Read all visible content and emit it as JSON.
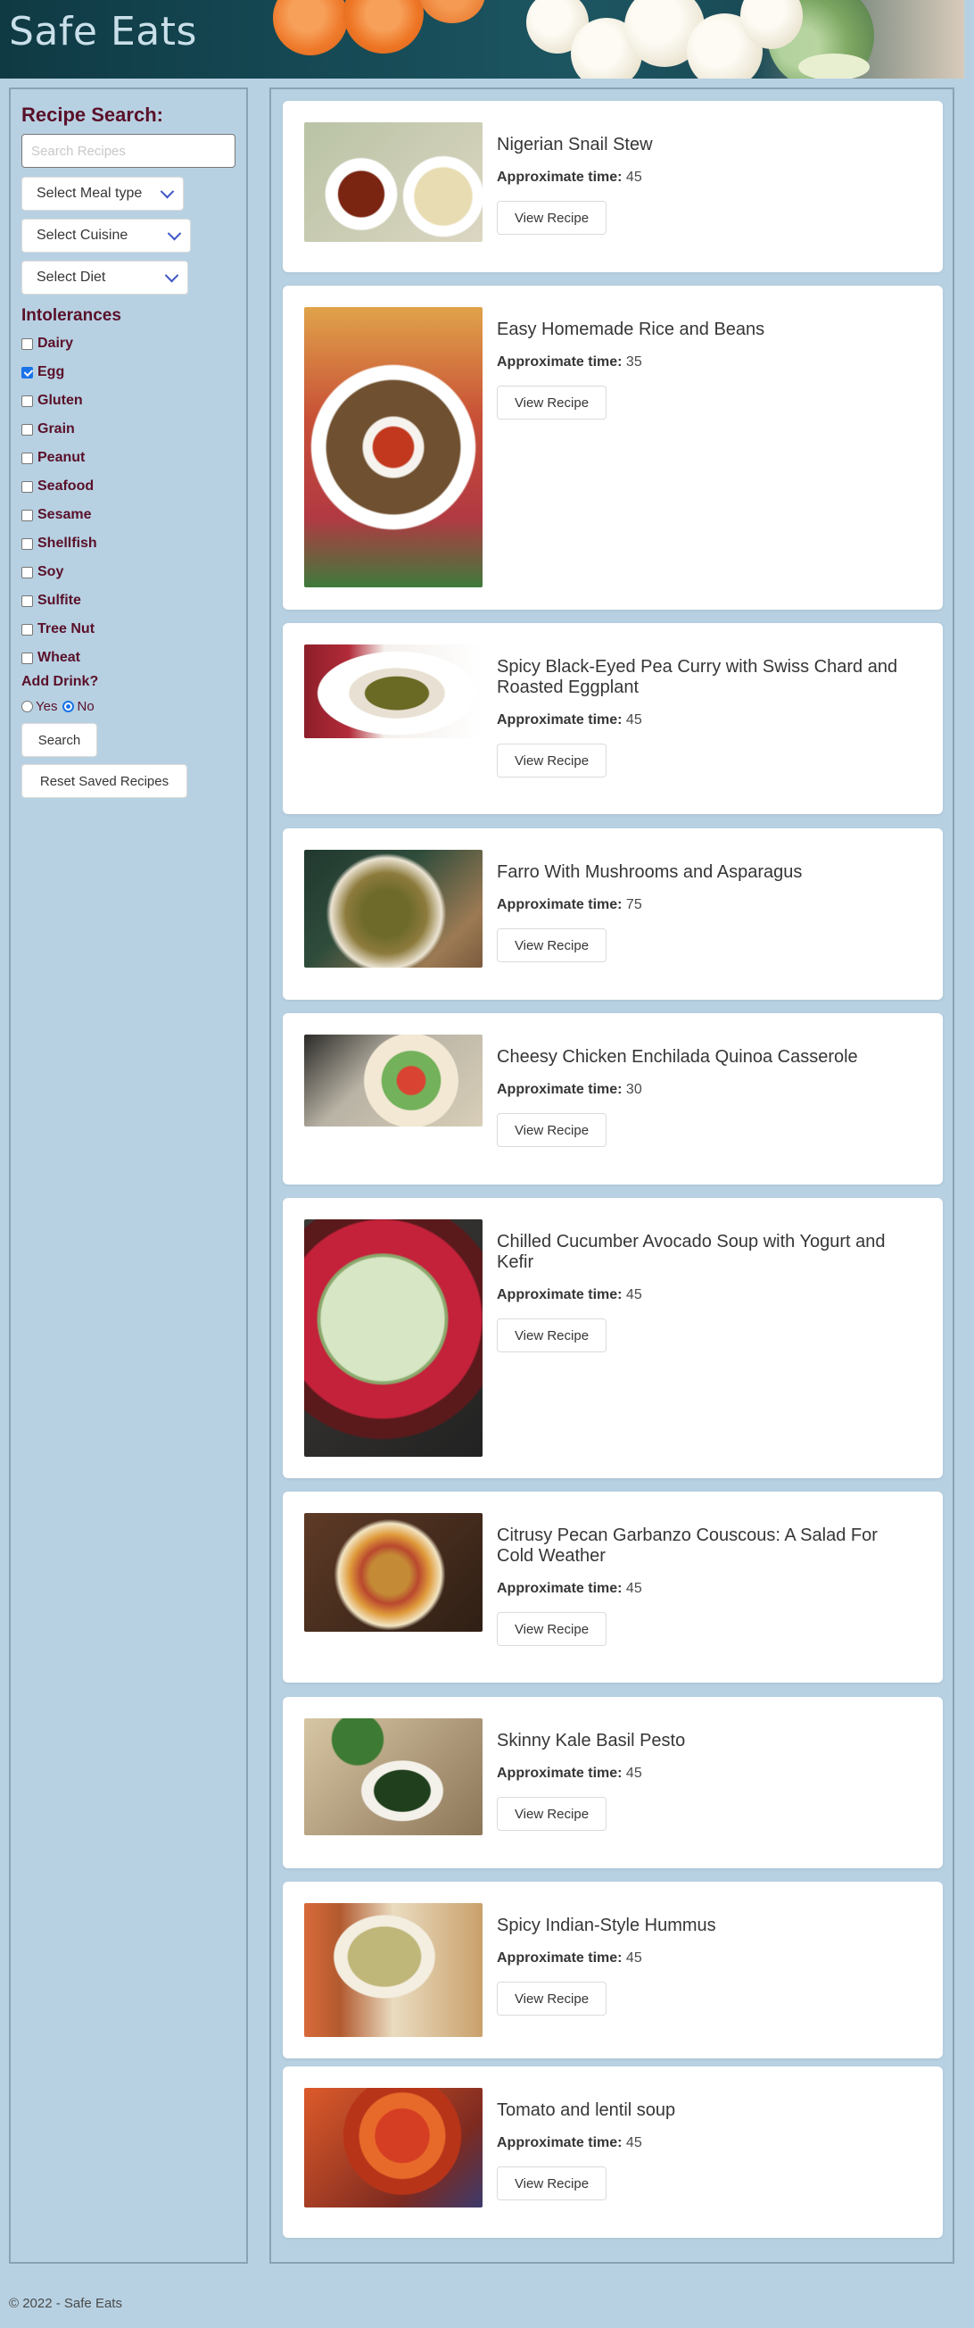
{
  "header": {
    "title": "Safe Eats"
  },
  "sidebar": {
    "heading": "Recipe Search:",
    "search_placeholder": "Search Recipes",
    "meal_type": "Select Meal type",
    "cuisine": "Select Cuisine",
    "diet": "Select Diet",
    "intolerances_title": "Intolerances",
    "intolerances": [
      {
        "label": "Dairy",
        "checked": false
      },
      {
        "label": "Egg",
        "checked": true
      },
      {
        "label": "Gluten",
        "checked": false
      },
      {
        "label": "Grain",
        "checked": false
      },
      {
        "label": "Peanut",
        "checked": false
      },
      {
        "label": "Seafood",
        "checked": false
      },
      {
        "label": "Sesame",
        "checked": false
      },
      {
        "label": "Shellfish",
        "checked": false
      },
      {
        "label": "Soy",
        "checked": false
      },
      {
        "label": "Sulfite",
        "checked": false
      },
      {
        "label": "Tree Nut",
        "checked": false
      },
      {
        "label": "Wheat",
        "checked": false
      }
    ],
    "drink_title": "Add Drink?",
    "drink_yes": "Yes",
    "drink_no": "No",
    "drink_selected": "No",
    "search_button": "Search",
    "reset_button": "Reset Saved Recipes"
  },
  "recipes": {
    "time_label": "Approximate time:",
    "view_label": "View Recipe",
    "items": [
      {
        "title": "Nigerian Snail Stew",
        "time": "45",
        "image": "snail-stew-photo"
      },
      {
        "title": "Easy Homemade Rice and Beans",
        "time": "35",
        "image": "rice-beans-photo"
      },
      {
        "title": "Spicy Black-Eyed Pea Curry with Swiss Chard and Roasted Eggplant",
        "time": "45",
        "image": "pea-curry-photo"
      },
      {
        "title": "Farro With Mushrooms and Asparagus",
        "time": "75",
        "image": "farro-photo"
      },
      {
        "title": "Cheesy Chicken Enchilada Quinoa Casserole",
        "time": "30",
        "image": "casserole-photo"
      },
      {
        "title": "Chilled Cucumber Avocado Soup with Yogurt and Kefir",
        "time": "45",
        "image": "cucumber-soup-photo"
      },
      {
        "title": "Citrusy Pecan Garbanzo Couscous: A Salad For Cold Weather",
        "time": "45",
        "image": "couscous-photo"
      },
      {
        "title": "Skinny Kale Basil Pesto",
        "time": "45",
        "image": "pesto-photo"
      },
      {
        "title": "Spicy Indian-Style Hummus",
        "time": "45",
        "image": "hummus-photo"
      },
      {
        "title": "Tomato and lentil soup",
        "time": "45",
        "image": "lentil-soup-photo"
      }
    ]
  },
  "footer": {
    "text": "© 2022 - Safe Eats"
  }
}
